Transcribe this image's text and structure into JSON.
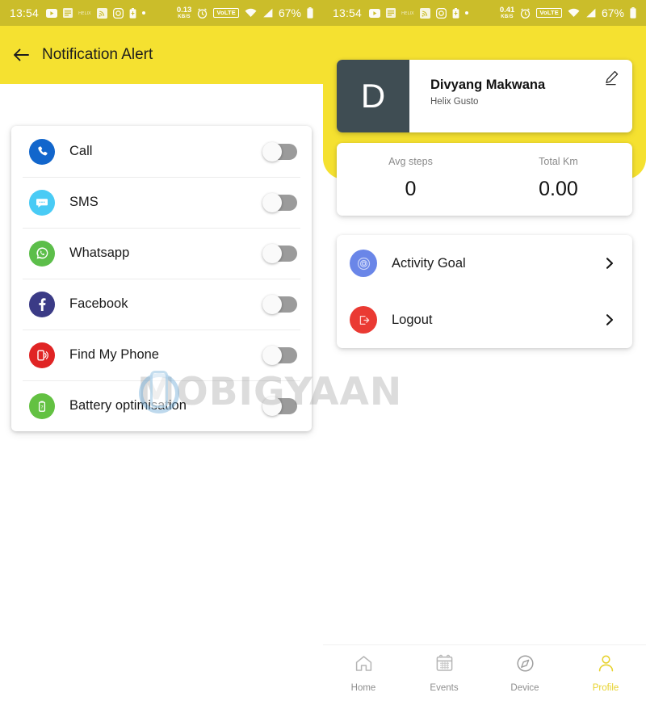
{
  "status_bar_left": {
    "time": "13:54",
    "icons": [
      "youtube-icon",
      "file-icon",
      "helix-icon",
      "cast-icon",
      "instagram-icon",
      "battery-saver-icon",
      "dot-icon"
    ],
    "data_rate_value": "0.13",
    "data_rate_unit": "KB/S",
    "alarm_icon": "alarm-icon",
    "network_badge": "VoLTE",
    "wifi_icon": "wifi-icon",
    "signal_icon": "signal-icon",
    "battery_percent": "67%"
  },
  "status_bar_right": {
    "time": "13:54",
    "icons": [
      "youtube-icon",
      "file-icon",
      "helix-icon",
      "cast-icon",
      "instagram-icon",
      "battery-saver-icon",
      "dot-icon"
    ],
    "data_rate_value": "0.41",
    "data_rate_unit": "KB/S",
    "alarm_icon": "alarm-icon",
    "network_badge": "VoLTE",
    "wifi_icon": "wifi-icon",
    "signal_icon": "signal-icon",
    "battery_percent": "67%"
  },
  "notification_screen": {
    "title": "Notification Alert",
    "back_icon": "back-arrow-icon",
    "items": [
      {
        "label": "Call",
        "icon": "phone-icon",
        "color": "#1266CC",
        "enabled": false
      },
      {
        "label": "SMS",
        "icon": "message-icon",
        "color": "#49CBF5",
        "enabled": false
      },
      {
        "label": "Whatsapp",
        "icon": "whatsapp-icon",
        "color": "#5CBE4A",
        "enabled": false
      },
      {
        "label": "Facebook",
        "icon": "facebook-icon",
        "color": "#3B3B86",
        "enabled": false
      },
      {
        "label": "Find My Phone",
        "icon": "find-phone-icon",
        "color": "#E02424",
        "enabled": false
      },
      {
        "label": "Battery optimisation",
        "icon": "battery-icon",
        "color": "#63C142",
        "enabled": false
      }
    ]
  },
  "profile_screen": {
    "profile": {
      "avatar_initial": "D",
      "name": "Divyang Makwana",
      "subtitle": "Helix Gusto",
      "edit_icon": "pencil-icon"
    },
    "stats": [
      {
        "label": "Avg steps",
        "value": "0"
      },
      {
        "label": "Total Km",
        "value": "0.00"
      }
    ],
    "menu": [
      {
        "label": "Activity Goal",
        "icon": "goal-icon",
        "color": "#6A86E8"
      },
      {
        "label": "Logout",
        "icon": "logout-icon",
        "color": "#EA3A33"
      }
    ],
    "bottom_nav": [
      {
        "label": "Home",
        "icon": "home-icon",
        "active": false
      },
      {
        "label": "Events",
        "icon": "calendar-icon",
        "active": false
      },
      {
        "label": "Device",
        "icon": "compass-icon",
        "active": false
      },
      {
        "label": "Profile",
        "icon": "person-icon",
        "active": true
      }
    ]
  },
  "watermark": {
    "text": "MOBIGYAAN"
  },
  "colors": {
    "brand_yellow": "#F5E130",
    "status_bar_yellow": "#CBBD2A",
    "avatar_slate": "#3F4D53",
    "active_nav": "#E7D22E"
  }
}
